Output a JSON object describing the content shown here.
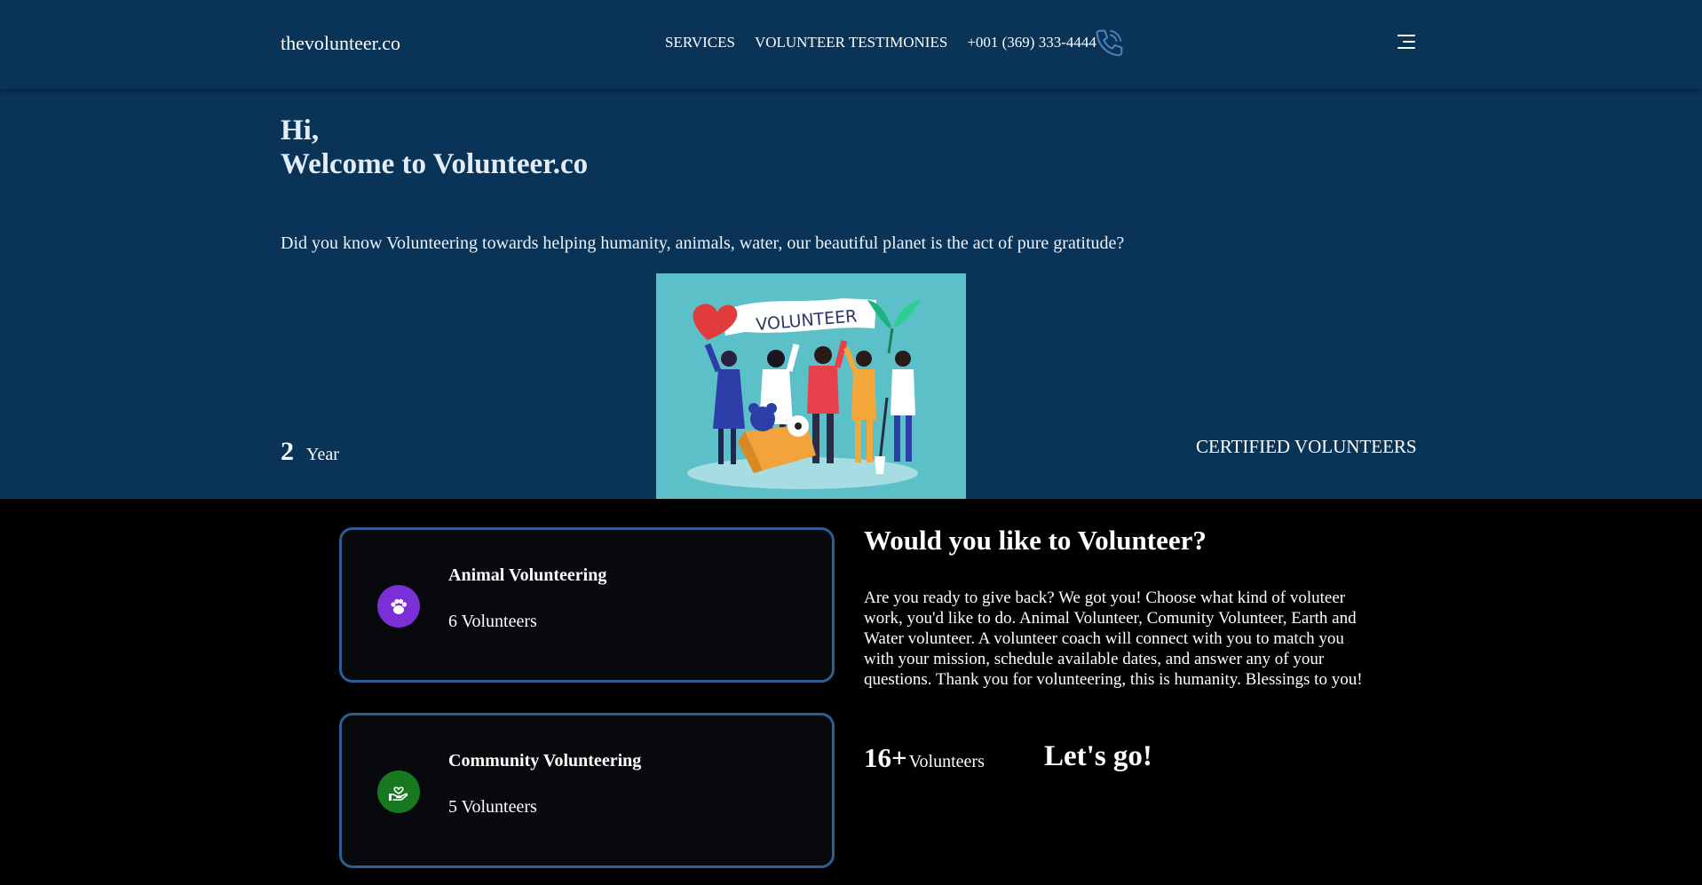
{
  "nav": {
    "brand": "thevolunteer.co",
    "links": [
      "SERVICES",
      "VOLUNTEER TESTIMONIES",
      "+001 (369) 333-4444"
    ],
    "phone_icon": "phone-icon",
    "menu_icon": "hamburger-menu-icon"
  },
  "hero": {
    "greeting_line1": "Hi,",
    "greeting_line2": "Welcome to Volunteer.co",
    "tagline": "Did you know Volunteering towards helping humanity, animals, water, our beautiful planet is the act of pure gratitude?",
    "illustration_banner": "VOLUNTEER",
    "year_value": "2",
    "year_label": "Year",
    "certified_label": "CERTIFIED VOLUNTEERS"
  },
  "cards": [
    {
      "title": "Animal Volunteering",
      "count": "6 Volunteers",
      "icon": "paw-icon",
      "icon_color": "#7b2fd6"
    },
    {
      "title": "Community Volunteering",
      "count": "5 Volunteers",
      "icon": "hand-heart-icon",
      "icon_color": "#17781f"
    }
  ],
  "cta": {
    "title": "Would you like to Volunteer?",
    "body": "Are you ready to give back? We got you! Choose what kind of voluteer work, you'd like to do. Animal Volunteer, Comunity Volunteer, Earth and Water volunteer. A volunteer coach will connect with you to match you with your mission, schedule available dates, and answer any of your questions. Thank you for volunteering, this is humanity. Blessings to you!",
    "stat_value": "16+",
    "stat_label": "Volunteers",
    "go_label": "Let's go!"
  },
  "colors": {
    "header_bg": "#0a3358",
    "page_bg": "#000000",
    "card_border": "#2d5d93",
    "illustration_bg": "#5cc0c9"
  }
}
